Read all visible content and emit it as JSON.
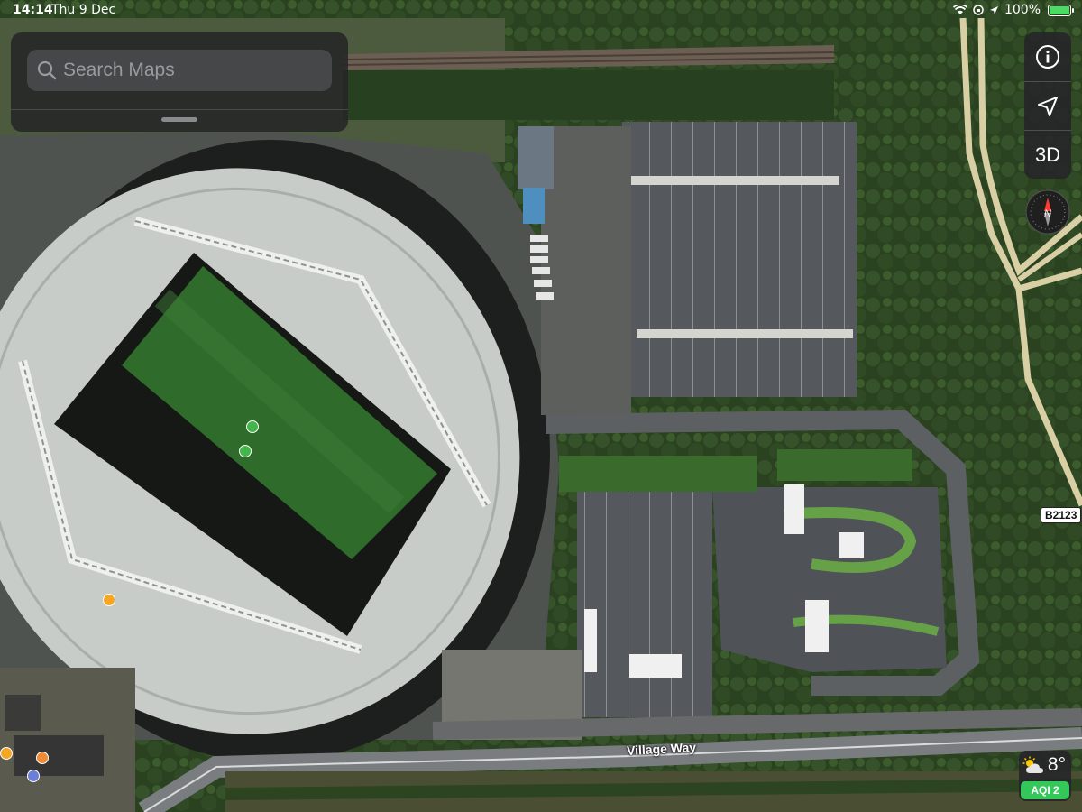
{
  "status_bar": {
    "time": "14:14",
    "date": "Thu 9 Dec",
    "battery": "100%"
  },
  "search": {
    "placeholder": "Search Maps"
  },
  "map_controls": {
    "info_icon": "info-icon",
    "location_icon": "location-arrow-icon",
    "mode_3d": "3D",
    "compass_label": "N"
  },
  "map_labels": {
    "road_shield": "B2123",
    "street": "Village Way"
  },
  "weather": {
    "temperature": "8°",
    "aqi": "AQI 2"
  },
  "colors": {
    "pitch": "#2f6b2a",
    "roof": "#c9ceca",
    "asphalt": "#4a4d52",
    "aqi_green": "#34c759",
    "panel": "#262628"
  }
}
